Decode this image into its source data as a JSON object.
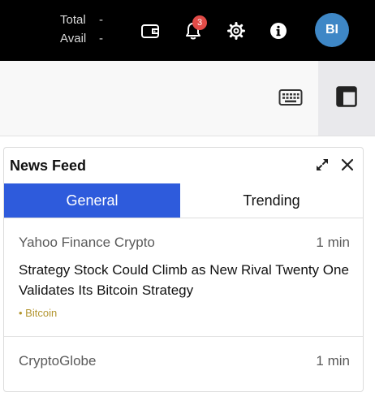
{
  "header": {
    "balance": {
      "total_label": "Total",
      "total_value": "-",
      "avail_label": "Avail",
      "avail_value": "-"
    },
    "icons": [
      "wallet-icon",
      "bell-icon",
      "gear-icon",
      "info-icon"
    ],
    "notifications_count": "3",
    "avatar_initials": "BI"
  },
  "toolbar": {
    "icons": [
      "keyboard-icon",
      "layout-icon"
    ]
  },
  "news_panel": {
    "title": "News Feed",
    "tabs": [
      {
        "label": "General",
        "active": true
      },
      {
        "label": "Trending",
        "active": false
      }
    ],
    "items": [
      {
        "source": "Yahoo Finance Crypto",
        "age": "1 min",
        "headline": "Strategy Stock Could Climb as New Rival Twenty One Validates Its Bitcoin Strategy",
        "tag": "• Bitcoin"
      },
      {
        "source": "CryptoGlobe",
        "age": "1 min"
      }
    ]
  },
  "colors": {
    "topbar_bg": "#000000",
    "accent_blue": "#2e5bdc",
    "badge_red": "#e14b47",
    "avatar_blue": "#3e87c6",
    "tag_gold": "#b3952f"
  }
}
